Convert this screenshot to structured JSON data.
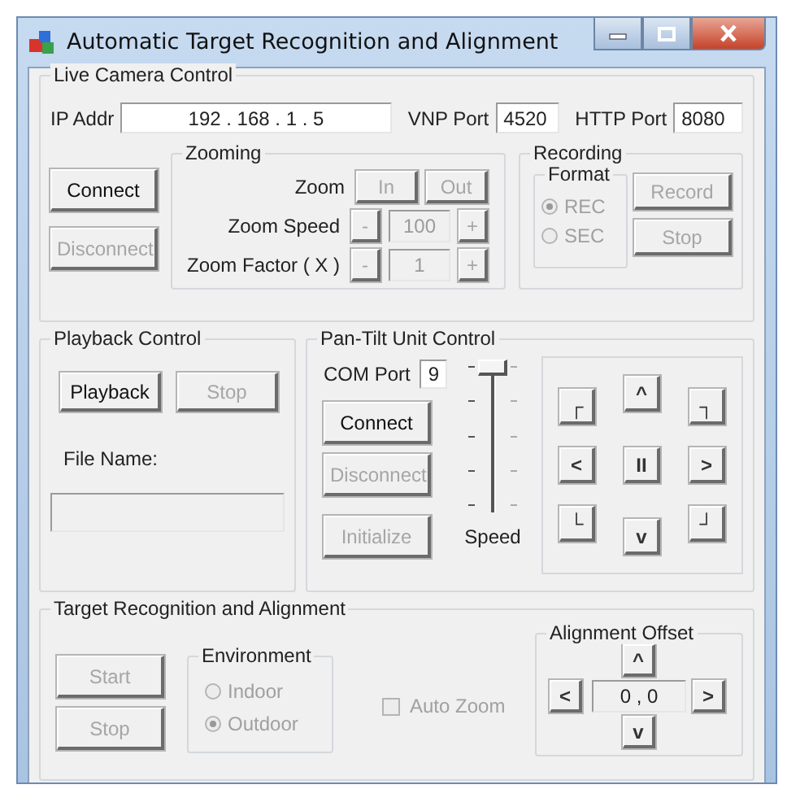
{
  "window": {
    "title": "Automatic Target Recognition and Alignment"
  },
  "live_camera": {
    "title": "Live Camera Control",
    "ip_label": "IP Addr",
    "ip_value": "192 . 168 . 1 . 5",
    "vnp_label": "VNP Port",
    "vnp_value": "4520",
    "http_label": "HTTP Port",
    "http_value": "8080",
    "buttons": [
      {
        "label": "Connect",
        "disabled": false
      },
      {
        "label": "Disconnect",
        "disabled": true
      }
    ],
    "zooming": {
      "title": "Zooming",
      "rows": [
        {
          "kind": "buttons",
          "label": "Zoom",
          "buttons": [
            {
              "label": "In",
              "disabled": true
            },
            {
              "label": "Out",
              "disabled": true
            }
          ]
        },
        {
          "kind": "spin",
          "label": "Zoom Speed",
          "minus": "-",
          "value": "100",
          "plus": "+",
          "disabled": true
        },
        {
          "kind": "spin",
          "label": "Zoom Factor ( X )",
          "minus": "-",
          "value": "1",
          "plus": "+",
          "disabled": true
        }
      ]
    },
    "recording": {
      "title": "Recording",
      "format": {
        "title": "Format",
        "options": [
          {
            "label": "REC",
            "selected": true,
            "disabled": true
          },
          {
            "label": "SEC",
            "selected": false,
            "disabled": true
          }
        ]
      },
      "buttons": [
        {
          "label": "Record",
          "disabled": true
        },
        {
          "label": "Stop",
          "disabled": true
        }
      ]
    }
  },
  "playback": {
    "title": "Playback Control",
    "buttons": [
      {
        "label": "Playback",
        "disabled": false
      },
      {
        "label": "Stop",
        "disabled": true
      }
    ],
    "file_label": "File Name:",
    "file_field": {
      "disabled": true
    }
  },
  "pan_tilt": {
    "title": "Pan-Tilt Unit Control",
    "com_label": "COM Port",
    "com_value": "9",
    "buttons": [
      {
        "label": "Connect",
        "disabled": false
      },
      {
        "label": "Disconnect",
        "disabled": true
      },
      {
        "label": "Initialize",
        "disabled": true
      }
    ],
    "speed": {
      "label": "Speed",
      "level": 1
    },
    "pad": [
      {
        "glyph": "┌",
        "disabled": false
      },
      {
        "glyph": "^",
        "disabled": false
      },
      {
        "glyph": "┐",
        "disabled": false
      },
      {
        "glyph": "<",
        "disabled": false
      },
      {
        "glyph": "II",
        "disabled": false
      },
      {
        "glyph": ">",
        "disabled": false
      },
      {
        "glyph": "└",
        "disabled": false
      },
      {
        "glyph": "v",
        "disabled": false
      },
      {
        "glyph": "┘",
        "disabled": false
      }
    ]
  },
  "target": {
    "title": "Target Recognition and Alignment",
    "buttons": [
      {
        "label": "Start",
        "disabled": true
      },
      {
        "label": "Stop",
        "disabled": true
      }
    ],
    "environment": {
      "title": "Environment",
      "options": [
        {
          "label": "Indoor",
          "selected": false,
          "disabled": true
        },
        {
          "label": "Outdoor",
          "selected": true,
          "disabled": true
        }
      ]
    },
    "auto_zoom": {
      "label": "Auto Zoom",
      "checked": false,
      "disabled": true
    },
    "offset": {
      "title": "Alignment Offset",
      "up": "^",
      "left": "<",
      "value": "0 , 0",
      "right": ">",
      "down": "v"
    }
  }
}
